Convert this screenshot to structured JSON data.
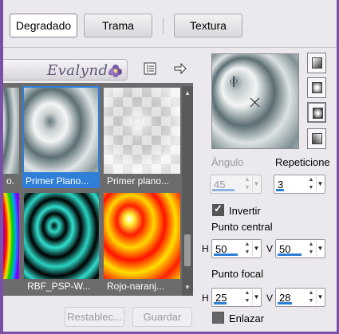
{
  "tabs": [
    {
      "label": "Degradado",
      "active": true
    },
    {
      "label": "Trama",
      "active": false
    },
    {
      "label": "Textura",
      "active": false
    }
  ],
  "gallery": {
    "logo_text": "Evalynda",
    "items": [
      {
        "label": "o.",
        "selected": false
      },
      {
        "label": "Primer Plano...",
        "selected": true
      },
      {
        "label": "Primer plano...",
        "selected": false
      },
      {
        "label": "",
        "selected": false
      },
      {
        "label": "RBF_PSP-W...",
        "selected": false
      },
      {
        "label": "Rojo-naranj...",
        "selected": false
      }
    ]
  },
  "buttons": {
    "reset": "Restablec...",
    "save": "Guardar"
  },
  "angle": {
    "label": "Ángulo",
    "value": "45",
    "enabled": false
  },
  "repeats": {
    "label": "Repeticione",
    "value": "3"
  },
  "invert": {
    "label": "Invertir",
    "checked": true
  },
  "center_point": {
    "label": "Punto central",
    "h_label": "H",
    "h_value": "50",
    "v_label": "V",
    "v_value": "50"
  },
  "focal_point": {
    "label": "Punto focal",
    "h_label": "H",
    "h_value": "25",
    "v_label": "V",
    "v_value": "28"
  },
  "link": {
    "label": "Enlazar",
    "checked": false
  },
  "colors": {
    "accent": "#2f7fd8",
    "frame": "#7a4fa6"
  }
}
